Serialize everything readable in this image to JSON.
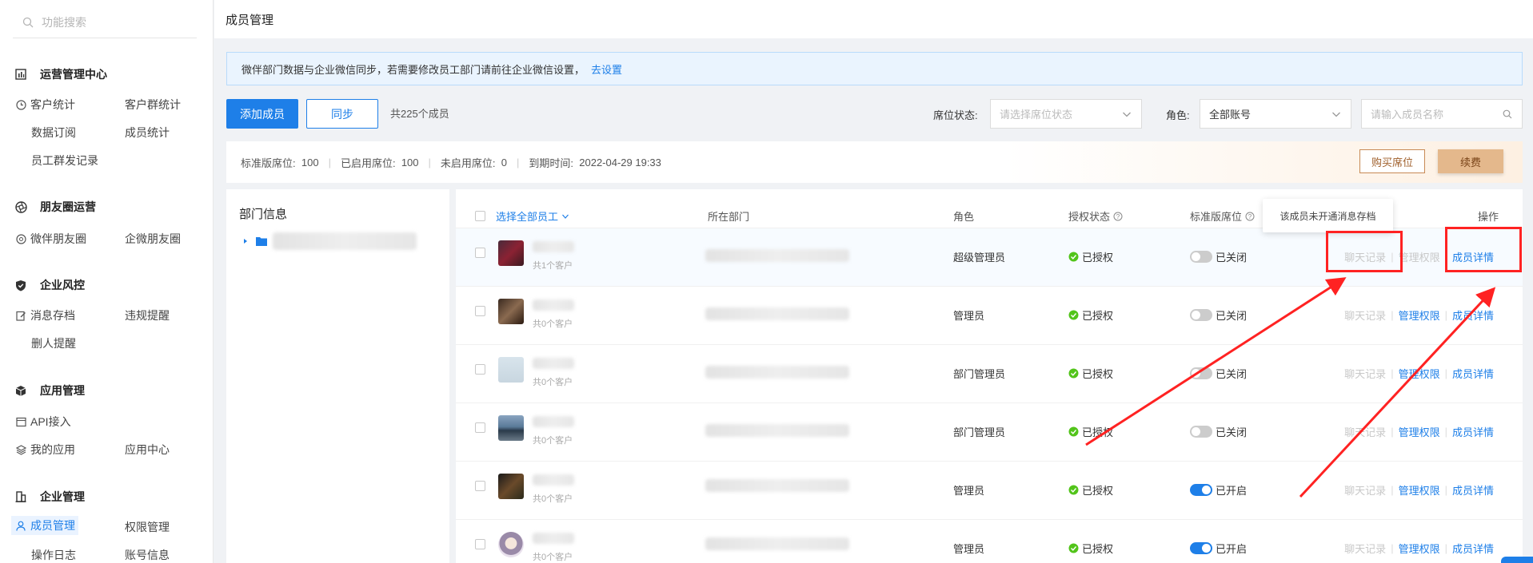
{
  "sidebar": {
    "search_placeholder": "功能搜索",
    "sections": [
      {
        "title": "运营管理中心",
        "icon": "bar-chart-icon",
        "items": [
          "客户统计",
          "客户群统计",
          "数据订阅",
          "成员统计",
          "员工群发记录"
        ]
      },
      {
        "title": "朋友圈运营",
        "icon": "aperture-icon",
        "items": [
          "微伴朋友圈",
          "企微朋友圈"
        ]
      },
      {
        "title": "企业风控",
        "icon": "shield-icon",
        "items": [
          "消息存档",
          "违规提醒",
          "删人提醒"
        ]
      },
      {
        "title": "应用管理",
        "icon": "cube-icon",
        "items": [
          "API接入",
          "我的应用",
          "应用中心"
        ]
      },
      {
        "title": "企业管理",
        "icon": "building-icon",
        "items": [
          "成员管理",
          "权限管理",
          "操作日志",
          "账号信息"
        ]
      }
    ]
  },
  "page_title": "成员管理",
  "notice": {
    "text": "微伴部门数据与企业微信同步，若需要修改员工部门请前往企业微信设置，",
    "link": "去设置"
  },
  "toolbar": {
    "add_label": "添加成员",
    "sync_label": "同步",
    "count_text": "共225个成员",
    "seat_status_label": "席位状态:",
    "seat_status_placeholder": "请选择席位状态",
    "role_label": "角色:",
    "role_value": "全部账号",
    "search_placeholder": "请输入成员名称"
  },
  "seatbar": {
    "std_label": "标准版席位:",
    "std_value": "100",
    "enabled_label": "已启用席位:",
    "enabled_value": "100",
    "disabled_label": "未启用席位:",
    "disabled_value": "0",
    "expire_label": "到期时间:",
    "expire_value": "2022-04-29 19:33",
    "buy_label": "购买席位",
    "renew_label": "续费"
  },
  "dept": {
    "title": "部门信息"
  },
  "table": {
    "headers": {
      "select_all": "选择全部员工",
      "dept": "所在部门",
      "role": "角色",
      "auth": "授权状态",
      "seat": "标准版席位",
      "ops": "操作"
    },
    "tooltip": "该成员未开通消息存档",
    "ops_labels": {
      "chat": "聊天记录",
      "perm": "管理权限",
      "detail": "成员详情"
    },
    "rows": [
      {
        "customers": "共1个客户",
        "role": "超级管理员",
        "auth": "已授权",
        "seat": "已关闭",
        "seat_on": false
      },
      {
        "customers": "共0个客户",
        "role": "管理员",
        "auth": "已授权",
        "seat": "已关闭",
        "seat_on": false
      },
      {
        "customers": "共0个客户",
        "role": "部门管理员",
        "auth": "已授权",
        "seat": "已关闭",
        "seat_on": false
      },
      {
        "customers": "共0个客户",
        "role": "部门管理员",
        "auth": "已授权",
        "seat": "已关闭",
        "seat_on": false
      },
      {
        "customers": "共0个客户",
        "role": "管理员",
        "auth": "已授权",
        "seat": "已开启",
        "seat_on": true
      },
      {
        "customers": "共0个客户",
        "role": "管理员",
        "auth": "已授权",
        "seat": "已开启",
        "seat_on": true
      }
    ]
  },
  "colors": {
    "primary": "#1e7fe8",
    "success": "#52c41a",
    "annotation": "#ff2222"
  }
}
